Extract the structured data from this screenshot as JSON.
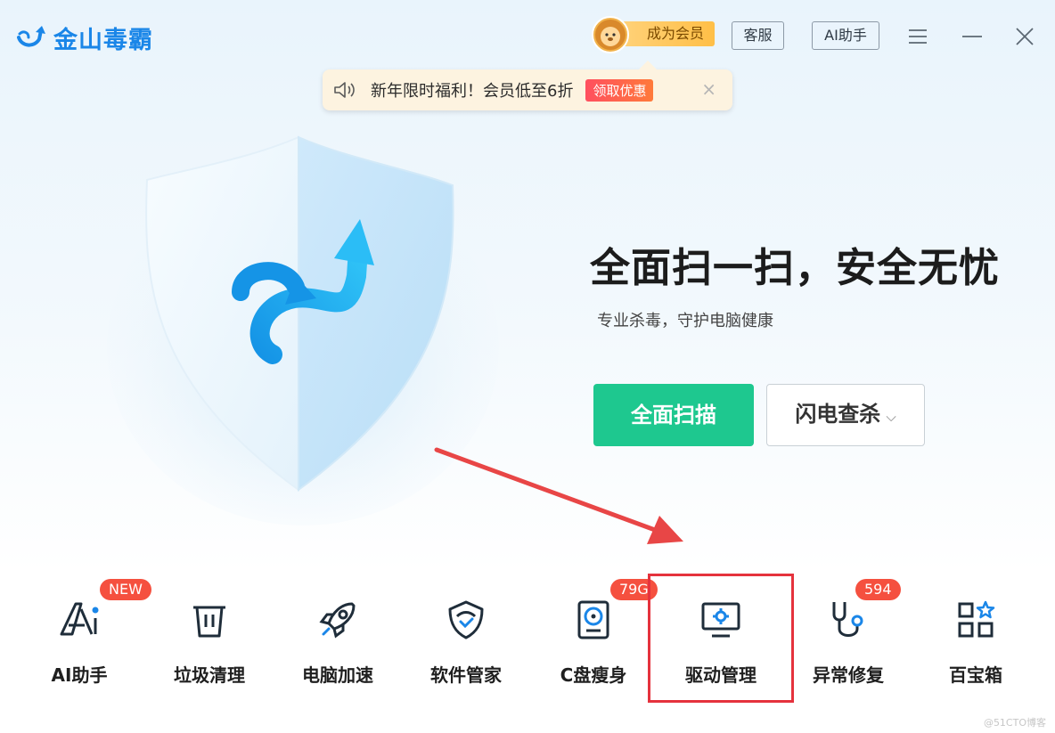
{
  "app": {
    "name": "金山毒霸"
  },
  "header": {
    "vip_label": "成为会员",
    "service_label": "客服",
    "ai_label": "AI助手",
    "menu_icon": "menu-icon",
    "minimize_icon": "minimize-icon",
    "close_icon": "close-icon"
  },
  "promo": {
    "text": "新年限时福利！会员低至6折",
    "button": "领取优惠",
    "close": "×",
    "icon": "speaker-icon"
  },
  "hero": {
    "title": "全面扫一扫，安全无忧",
    "subtitle": "专业杀毒，守护电脑健康",
    "scan_button": "全面扫描",
    "quick_button": "闪电查杀",
    "quick_chevron": "⌵"
  },
  "tools": [
    {
      "label": "AI助手",
      "icon": "ai-icon",
      "badge": "NEW"
    },
    {
      "label": "垃圾清理",
      "icon": "trash-icon",
      "badge": ""
    },
    {
      "label": "电脑加速",
      "icon": "rocket-icon",
      "badge": ""
    },
    {
      "label": "软件管家",
      "icon": "shield-check-icon",
      "badge": ""
    },
    {
      "label": "C盘瘦身",
      "icon": "disk-icon",
      "badge": "79G"
    },
    {
      "label": "驱动管理",
      "icon": "monitor-gear-icon",
      "badge": ""
    },
    {
      "label": "异常修复",
      "icon": "stethoscope-icon",
      "badge": "594"
    },
    {
      "label": "百宝箱",
      "icon": "apps-icon",
      "badge": ""
    }
  ],
  "watermark": "@51CTO博客",
  "colors": {
    "brand": "#1a86e8",
    "scan_green": "#1ec88f",
    "badge_red": "#f5503f",
    "highlight_red": "#e5323d"
  }
}
